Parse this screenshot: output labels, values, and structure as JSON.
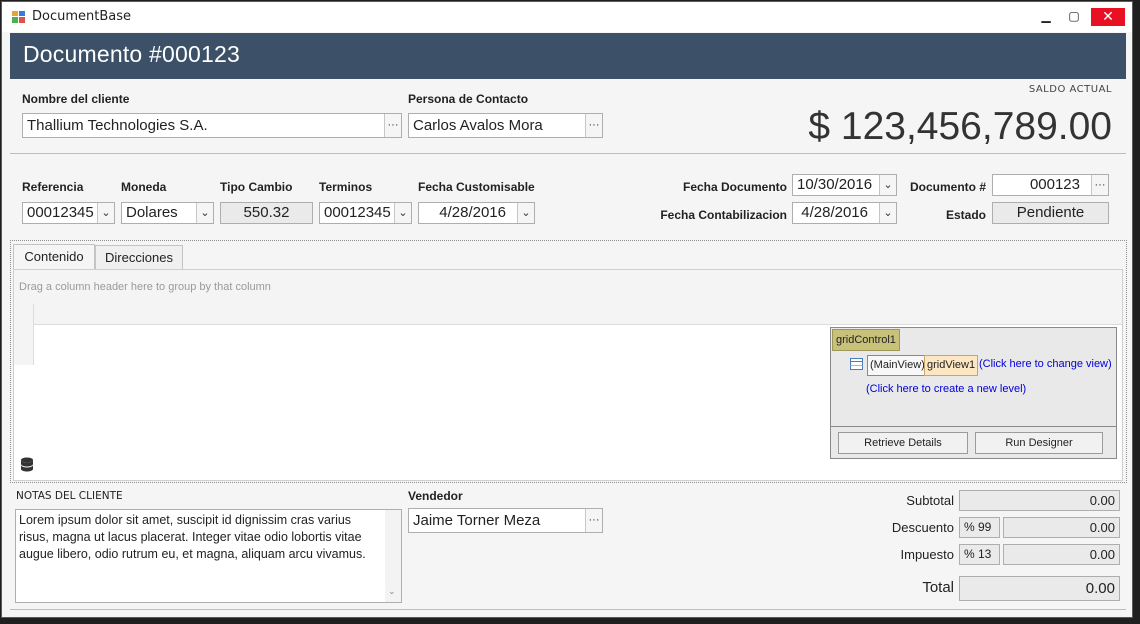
{
  "window": {
    "title": "DocumentBase",
    "minimize": "▁",
    "maximize": "▢",
    "close": "✕"
  },
  "header": {
    "title": "Documento  #000123"
  },
  "client": {
    "label": "Nombre del cliente",
    "value": "Thallium Technologies S.A."
  },
  "contact": {
    "label": "Persona de Contacto",
    "value": "Carlos Avalos Mora"
  },
  "balance": {
    "label": "SALDO ACTUAL",
    "value": "$ 123,456,789.00"
  },
  "fields": {
    "referencia": {
      "label": "Referencia",
      "value": "00012345"
    },
    "moneda": {
      "label": "Moneda",
      "value": "Dolares"
    },
    "tipo_cambio": {
      "label": "Tipo Cambio",
      "value": "550.32"
    },
    "terminos": {
      "label": "Terminos",
      "value": "00012345"
    },
    "fecha_custom": {
      "label": "Fecha Customisable",
      "value": "4/28/2016"
    },
    "fecha_documento": {
      "label": "Fecha Documento",
      "value": "10/30/2016"
    },
    "fecha_contab": {
      "label": "Fecha Contabilizacion",
      "value": "4/28/2016"
    },
    "documento_num": {
      "label": "Documento #",
      "value": "000123"
    },
    "estado": {
      "label": "Estado",
      "value": "Pendiente"
    }
  },
  "tabs": [
    {
      "label": "Contenido"
    },
    {
      "label": "Direcciones"
    }
  ],
  "grid": {
    "group_hint": "Drag a column header here to group by that column"
  },
  "designer": {
    "name": "gridControl1",
    "main_view": "(MainView)",
    "grid_view": "gridView1",
    "change_view": "(Click here to change view)",
    "new_level": "(Click here to create a new level)",
    "retrieve_btn": "Retrieve Details",
    "run_btn": "Run Designer"
  },
  "notes": {
    "label": "NOTAS DEL CLIENTE",
    "text": "Lorem ipsum dolor sit amet, suscipit id dignissim cras varius risus, magna ut lacus placerat. Integer vitae odio lobortis vitae augue libero, odio rutrum eu, et magna, aliquam arcu vivamus."
  },
  "vendor": {
    "label": "Vendedor",
    "value": "Jaime Torner Meza"
  },
  "totals": {
    "subtotal": {
      "label": "Subtotal",
      "value": "0.00"
    },
    "descuento": {
      "label": "Descuento",
      "pct": "% 99",
      "value": "0.00"
    },
    "impuesto": {
      "label": "Impuesto",
      "pct": "% 13",
      "value": "0.00"
    },
    "total": {
      "label": "Total",
      "value": "0.00"
    }
  },
  "icons": {
    "ellipsis": "···",
    "dropdown": "⌄"
  },
  "colors": {
    "header": "#3c5068",
    "close": "#e81123",
    "link": "#0000d8"
  }
}
